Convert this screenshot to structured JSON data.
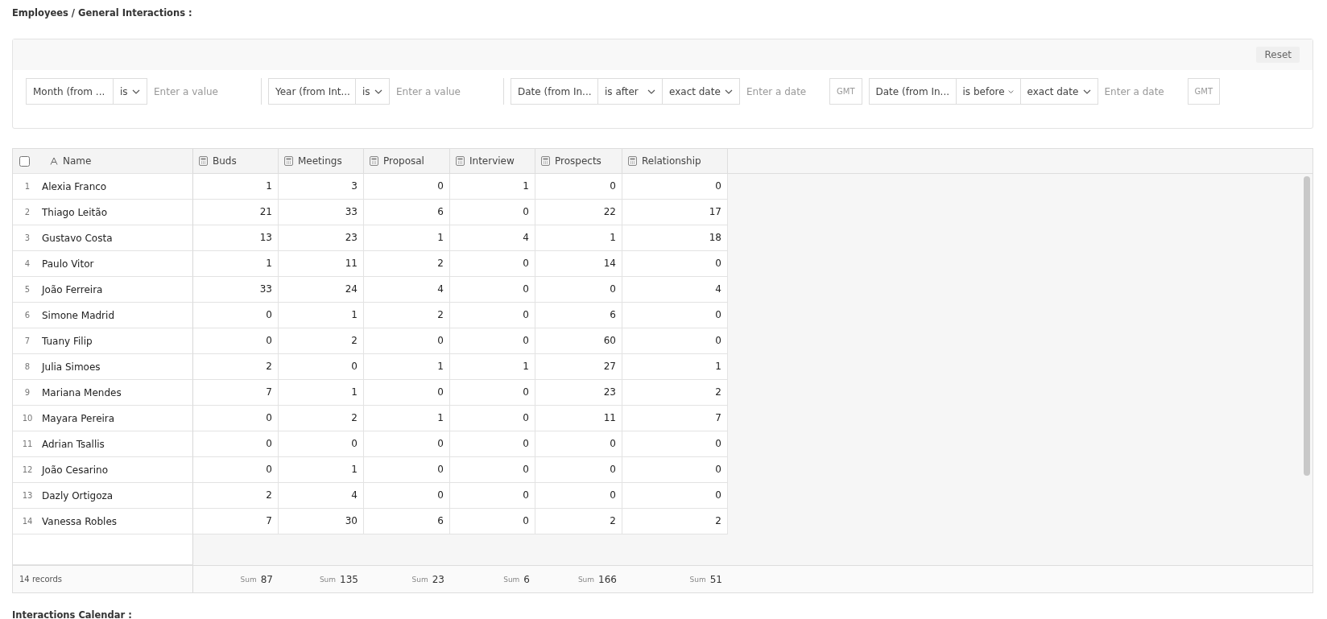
{
  "title": "Employees / General Interactions :",
  "filters_panel": {
    "reset_label": "Reset",
    "filters": [
      {
        "segments": [
          {
            "kind": "field",
            "text": "Month (from ..."
          },
          {
            "kind": "operator",
            "text": "is"
          },
          {
            "kind": "input",
            "placeholder": "Enter a value"
          }
        ]
      },
      {
        "segments": [
          {
            "kind": "field",
            "text": "Year (from Int..."
          },
          {
            "kind": "operator",
            "text": "is"
          },
          {
            "kind": "input",
            "placeholder": "Enter a value"
          }
        ]
      },
      {
        "segments": [
          {
            "kind": "field",
            "text": "Date (from In..."
          },
          {
            "kind": "operator",
            "text": "is after"
          },
          {
            "kind": "mode",
            "text": "exact date"
          },
          {
            "kind": "date",
            "placeholder": "Enter a date"
          },
          {
            "kind": "suffix",
            "text": "GMT"
          }
        ]
      },
      {
        "segments": [
          {
            "kind": "field",
            "text": "Date (from In..."
          },
          {
            "kind": "operator",
            "text": "is before"
          },
          {
            "kind": "mode",
            "text": "exact date"
          },
          {
            "kind": "date",
            "placeholder": "Enter a date"
          },
          {
            "kind": "suffix",
            "text": "GMT"
          }
        ]
      }
    ]
  },
  "table": {
    "select_all": {
      "checked": false
    },
    "name_column": "Name",
    "columns": [
      "Buds",
      "Meetings",
      "Proposal",
      "Interview",
      "Prospects",
      "Relationship"
    ],
    "rows": [
      {
        "index": "1",
        "name": "Alexia Franco",
        "values": [
          "1",
          "3",
          "0",
          "1",
          "0",
          "0"
        ]
      },
      {
        "index": "2",
        "name": "Thiago Leitão",
        "values": [
          "21",
          "33",
          "6",
          "0",
          "22",
          "17"
        ]
      },
      {
        "index": "3",
        "name": "Gustavo Costa",
        "values": [
          "13",
          "23",
          "1",
          "4",
          "1",
          "18"
        ]
      },
      {
        "index": "4",
        "name": "Paulo Vitor",
        "values": [
          "1",
          "11",
          "2",
          "0",
          "14",
          "0"
        ]
      },
      {
        "index": "5",
        "name": "João Ferreira",
        "values": [
          "33",
          "24",
          "4",
          "0",
          "0",
          "4"
        ]
      },
      {
        "index": "6",
        "name": "Simone Madrid",
        "values": [
          "0",
          "1",
          "2",
          "0",
          "6",
          "0"
        ]
      },
      {
        "index": "7",
        "name": "Tuany Filip",
        "values": [
          "0",
          "2",
          "0",
          "0",
          "60",
          "0"
        ]
      },
      {
        "index": "8",
        "name": "Julia Simoes",
        "values": [
          "2",
          "0",
          "1",
          "1",
          "27",
          "1"
        ]
      },
      {
        "index": "9",
        "name": "Mariana Mendes",
        "values": [
          "7",
          "1",
          "0",
          "0",
          "23",
          "2"
        ]
      },
      {
        "index": "10",
        "name": "Mayara Pereira",
        "values": [
          "0",
          "2",
          "1",
          "0",
          "11",
          "7"
        ]
      },
      {
        "index": "11",
        "name": "Adrian Tsallis",
        "values": [
          "0",
          "0",
          "0",
          "0",
          "0",
          "0"
        ]
      },
      {
        "index": "12",
        "name": "João Cesarino",
        "values": [
          "0",
          "1",
          "0",
          "0",
          "0",
          "0"
        ]
      },
      {
        "index": "13",
        "name": "Dazly Ortigoza",
        "values": [
          "2",
          "4",
          "0",
          "0",
          "0",
          "0"
        ]
      },
      {
        "index": "14",
        "name": "Vanessa Robles",
        "values": [
          "7",
          "30",
          "6",
          "0",
          "2",
          "2"
        ]
      }
    ],
    "footer": {
      "records": "14 records",
      "sums": [
        {
          "label": "Sum",
          "value": "87"
        },
        {
          "label": "Sum",
          "value": "135"
        },
        {
          "label": "Sum",
          "value": "23"
        },
        {
          "label": "Sum",
          "value": "6"
        },
        {
          "label": "Sum",
          "value": "166"
        },
        {
          "label": "Sum",
          "value": "51"
        }
      ]
    }
  },
  "next_section_title": "Interactions Calendar :"
}
